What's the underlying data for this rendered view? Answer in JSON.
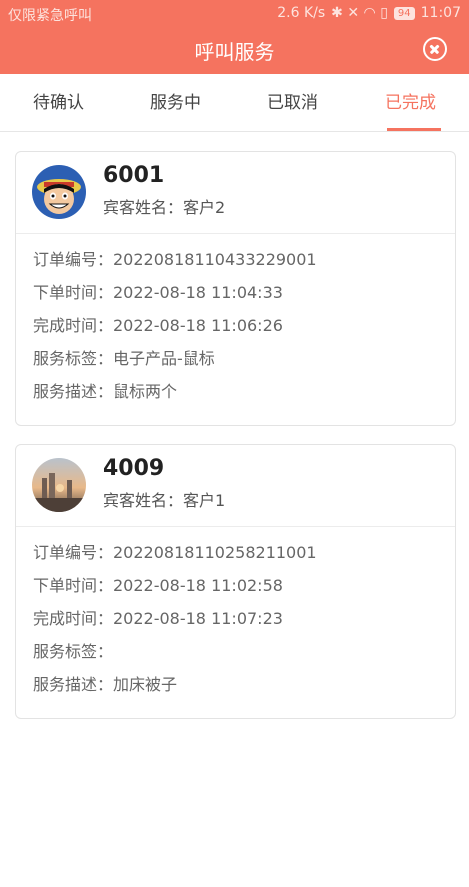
{
  "status_bar": {
    "left_text": "仅限紧急呼叫",
    "speed": "2.6 K/s",
    "icons_text": "✱ ✕ ◠ ▯",
    "battery": "94",
    "time": "11:07"
  },
  "header": {
    "title": "呼叫服务"
  },
  "tabs": [
    {
      "label": "待确认"
    },
    {
      "label": "服务中"
    },
    {
      "label": "已取消"
    },
    {
      "label": "已完成"
    }
  ],
  "active_tab": "已完成",
  "colors": {
    "accent": "#f5735f"
  },
  "orders": [
    {
      "room": "6001",
      "guest": "宾客姓名：客户2",
      "rows": [
        "订单编号：20220818110433229001",
        "下单时间：2022-08-18 11:04:33",
        "完成时间：2022-08-18 11:06:26",
        "服务标签：电子产品-鼠标",
        "服务描述：鼠标两个"
      ]
    },
    {
      "room": "4009",
      "guest": "宾客姓名：客户1",
      "rows": [
        "订单编号：20220818110258211001",
        "下单时间：2022-08-18 11:02:58",
        "完成时间：2022-08-18 11:07:23",
        "服务标签：",
        "服务描述：加床被子"
      ]
    }
  ]
}
